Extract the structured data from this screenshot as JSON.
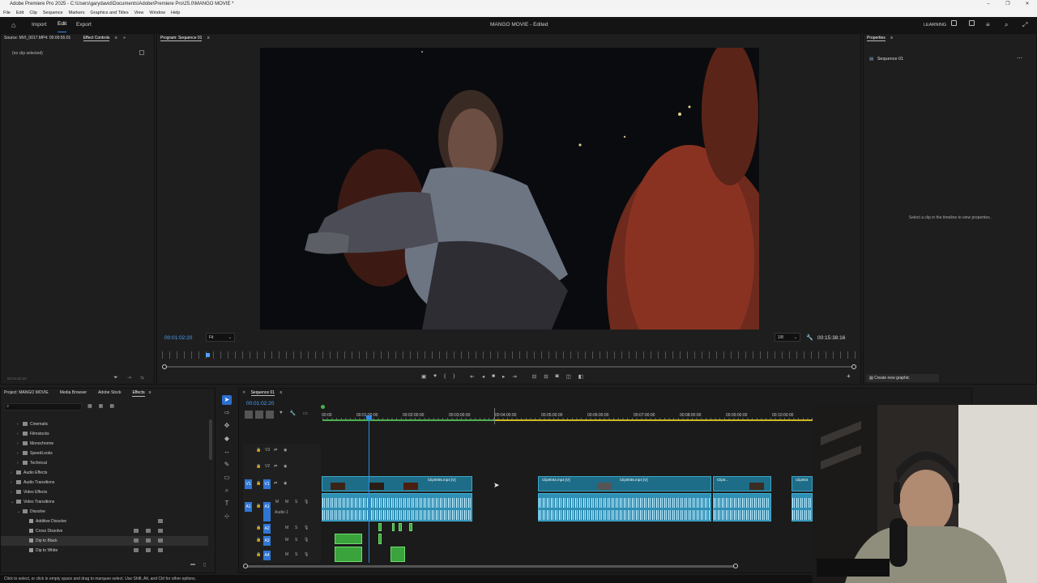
{
  "window": {
    "title": "Adobe Premiere Pro 2025 - C:\\Users\\garydavid\\Documents\\Adobe\\Premiere Pro\\25.0\\MANGO MOVIE *",
    "controls": [
      "–",
      "❐",
      "✕"
    ]
  },
  "menu": [
    "File",
    "Edit",
    "Clip",
    "Sequence",
    "Markers",
    "Graphics and Titles",
    "View",
    "Window",
    "Help"
  ],
  "appbar": {
    "workspaces": [
      "Import",
      "Edit",
      "Export"
    ],
    "active_workspace": "Edit",
    "project_title": "MANGO MOVIE - Edited",
    "learning_label": "LEARNING"
  },
  "source_panel": {
    "tab_source": "Source: MVI_0017.MP4: 00:00:55:01",
    "tab_effect_controls": "Effect Controls",
    "no_clip": "(no clip selected)",
    "timecode": "00:01:02:20"
  },
  "program_monitor": {
    "tab_label": "Program: Sequence 01",
    "timecode": "00:01:02:20",
    "fit_label": "Fit",
    "resolution": "1/8",
    "duration": "00:15:38:16"
  },
  "properties": {
    "tab_label": "Properties",
    "sequence_name": "Sequence 01",
    "empty_message": "Select a clip in the timeline to view properties.",
    "create_graphic": "Create new graphic"
  },
  "project_panel": {
    "tabs": [
      "Project: MANGO MOVIE",
      "Media Browser",
      "Adobe Stock",
      "Effects"
    ],
    "active_tab": "Effects",
    "tree": [
      {
        "label": "Cinematic",
        "indent": 1,
        "type": "folder"
      },
      {
        "label": "Filmstocks",
        "indent": 1,
        "type": "folder"
      },
      {
        "label": "Monochrome",
        "indent": 1,
        "type": "folder"
      },
      {
        "label": "SpeedLooks",
        "indent": 1,
        "type": "folder"
      },
      {
        "label": "Technical",
        "indent": 1,
        "type": "folder"
      },
      {
        "label": "Audio Effects",
        "indent": 0,
        "type": "folder"
      },
      {
        "label": "Audio Transitions",
        "indent": 0,
        "type": "folder"
      },
      {
        "label": "Video Effects",
        "indent": 0,
        "type": "folder"
      },
      {
        "label": "Video Transitions",
        "indent": 0,
        "type": "folder"
      },
      {
        "label": "Dissolve",
        "indent": 1,
        "type": "folder"
      },
      {
        "label": "Additive Dissolve",
        "indent": 2,
        "type": "fx",
        "badges": 1
      },
      {
        "label": "Cross Dissolve",
        "indent": 2,
        "type": "fx",
        "badges": 3
      },
      {
        "label": "Dip to Black",
        "indent": 2,
        "type": "fx",
        "badges": 3,
        "selected": true
      },
      {
        "label": "Dip to White",
        "indent": 2,
        "type": "fx",
        "badges": 3
      }
    ]
  },
  "timeline": {
    "tab_label": "Sequence 01",
    "timecode": "00:01:02:20",
    "ruler": [
      "00:00",
      "00:01:00:00",
      "00:02:00:00",
      "00:03:00:00",
      "00:04:00:00",
      "00:05:00:00",
      "00:06:00:00",
      "00:07:00:00",
      "00:08:00:00",
      "00:09:00:00",
      "00:10:00:00"
    ],
    "tracks": {
      "v3": "V3",
      "v2": "V2",
      "v1": "V1",
      "v1_src": "V1",
      "a1": "A1",
      "a1_src": "A1",
      "a1_name": "Audio 1",
      "a2": "A2",
      "a3": "A3",
      "a4": "A4",
      "m": "M",
      "s": "S"
    },
    "clips": {
      "c1": "Clip0005.mp4 [V]",
      "c2": "Clip0044.mp4 [V]",
      "c3": "Clip0036.mp4 [V]",
      "c4": "Clip0...",
      "c5": "Clip004"
    }
  },
  "status_bar": "Click to select, or click in empty space and drag to marquee select. Use Shift, Alt, and Ctrl for other options."
}
